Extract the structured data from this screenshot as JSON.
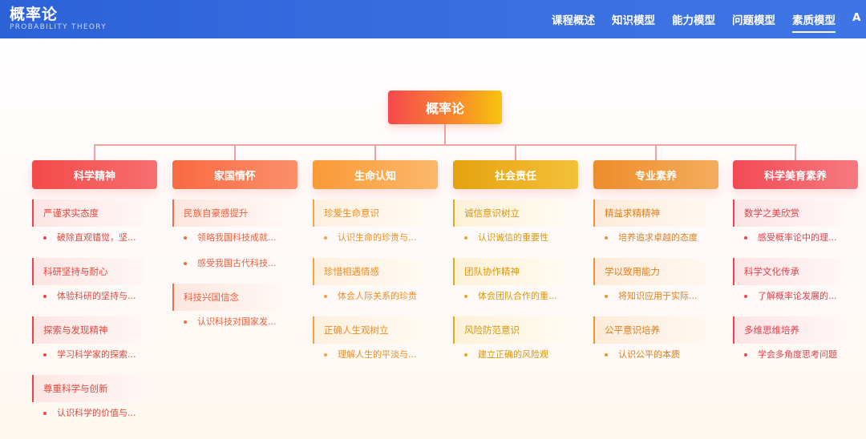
{
  "header": {
    "title": "概率论",
    "subtitle": "PROBABILITY THEORY",
    "nav": [
      "课程概述",
      "知识模型",
      "能力模型",
      "问题模型",
      "素质模型",
      "A"
    ],
    "active_nav": "素质模型"
  },
  "tree": {
    "root": "概率论",
    "columns": [
      {
        "title": "科学精神",
        "head_color": "linear-gradient(90deg,#f34a4a,#f76f6f)",
        "accent": "#ef4444",
        "text_color": "#e8453c",
        "item_bg": "linear-gradient(90deg,#fde5e3,#fff7f6)",
        "items": [
          {
            "label": "严谨求实态度",
            "subs": [
              "破除直观错觉，坚..."
            ]
          },
          {
            "label": "科研坚持与耐心",
            "subs": [
              "体验科研的坚持与..."
            ]
          },
          {
            "label": "探索与发现精神",
            "subs": [
              "学习科学家的探索..."
            ]
          },
          {
            "label": "尊重科学与创新",
            "subs": [
              "认识科学的价值与..."
            ]
          }
        ]
      },
      {
        "title": "家国情怀",
        "head_color": "linear-gradient(90deg,#f86a42,#fb8f6a)",
        "accent": "#f36a43",
        "text_color": "#ef5f3c",
        "item_bg": "linear-gradient(90deg,#fee6de,#fff8f5)",
        "items": [
          {
            "label": "民族自豪感提升",
            "subs": [
              "领略我国科技成就...",
              "感受我国古代科技..."
            ]
          },
          {
            "label": "科技兴国信念",
            "subs": [
              "认识科技对国家发..."
            ]
          }
        ]
      },
      {
        "title": "生命认知",
        "head_color": "linear-gradient(90deg,#f99a36,#fcb86a)",
        "accent": "#f7a240",
        "text_color": "#f08c22",
        "item_bg": "linear-gradient(90deg,#fef0de,#fffaf3)",
        "items": [
          {
            "label": "珍爱生命意识",
            "subs": [
              "认识生命的珍贵与..."
            ]
          },
          {
            "label": "珍惜相遇情感",
            "subs": [
              "体会人际关系的珍贵"
            ]
          },
          {
            "label": "正确人生观树立",
            "subs": [
              "理解人生的平淡与..."
            ]
          }
        ]
      },
      {
        "title": "社会责任",
        "head_color": "linear-gradient(90deg,#e5a20e,#f3c13a)",
        "accent": "#e6a81a",
        "text_color": "#d9960c",
        "item_bg": "linear-gradient(90deg,#fdf1d8,#fffbf1)",
        "items": [
          {
            "label": "诚信意识树立",
            "subs": [
              "认识诚信的重要性"
            ]
          },
          {
            "label": "团队协作精神",
            "subs": [
              "体会团队合作的重..."
            ]
          },
          {
            "label": "风险防范意识",
            "subs": [
              "建立正确的风险观"
            ]
          }
        ]
      },
      {
        "title": "专业素养",
        "head_color": "linear-gradient(90deg,#ed8c2a,#f5ad5c)",
        "accent": "#ee9233",
        "text_color": "#e27d1c",
        "item_bg": "linear-gradient(90deg,#fdebd9,#fff8f1)",
        "items": [
          {
            "label": "精益求精精神",
            "subs": [
              "培养追求卓越的态度"
            ]
          },
          {
            "label": "学以致用能力",
            "subs": [
              "将知识应用于实际..."
            ]
          },
          {
            "label": "公平意识培养",
            "subs": [
              "认识公平的本质"
            ]
          }
        ]
      },
      {
        "title": "科学美育素养",
        "head_color": "linear-gradient(90deg,#f24a55,#f67a80)",
        "accent": "#ef4450",
        "text_color": "#e4404a",
        "item_bg": "linear-gradient(90deg,#fde4e5,#fff7f7)",
        "items": [
          {
            "label": "数学之美欣赏",
            "subs": [
              "感受概率论中的理..."
            ]
          },
          {
            "label": "科学文化传承",
            "subs": [
              "了解概率论发展的..."
            ]
          },
          {
            "label": "多维思维培养",
            "subs": [
              "学会多角度思考问题"
            ]
          }
        ]
      }
    ]
  }
}
